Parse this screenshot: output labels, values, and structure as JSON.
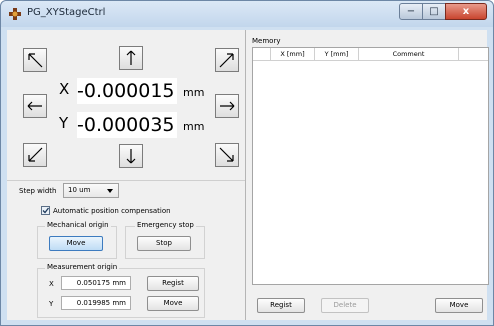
{
  "window": {
    "title": "PG_XYStageCtrl",
    "app_icon": "stage-control-icon",
    "controls": {
      "minimize": "−",
      "maximize": "□",
      "close": "x"
    }
  },
  "jog": {
    "arrows": [
      "up-left",
      "up",
      "up-right",
      "left",
      "right",
      "down-left",
      "down",
      "down-right"
    ],
    "x": {
      "label": "X",
      "value": "-0.000015",
      "unit": "mm"
    },
    "y": {
      "label": "Y",
      "value": "-0.000035",
      "unit": "mm"
    }
  },
  "settings": {
    "step_width_label": "Step width",
    "step_width_value": "10 um",
    "auto_comp_label": "Automatic position compensation",
    "auto_comp_checked": true
  },
  "mechanical_origin": {
    "title": "Mechanical origin",
    "move_label": "Move"
  },
  "emergency_stop": {
    "title": "Emergency stop",
    "stop_label": "Stop"
  },
  "measurement_origin": {
    "title": "Measurement origin",
    "x_label": "X",
    "x_value": "0.050175 mm",
    "y_label": "Y",
    "y_value": "0.019985 mm",
    "regist_label": "Regist",
    "move_label": "Move"
  },
  "memory": {
    "title": "Memory",
    "columns": [
      "",
      "X [mm]",
      "Y [mm]",
      "Comment"
    ],
    "rows": [],
    "regist_label": "Regist",
    "delete_label": "Delete",
    "move_label": "Move"
  },
  "colors": {
    "accent": "#3d7bbf",
    "close_button": "#c9452f",
    "panel": "#f0f0f0"
  }
}
